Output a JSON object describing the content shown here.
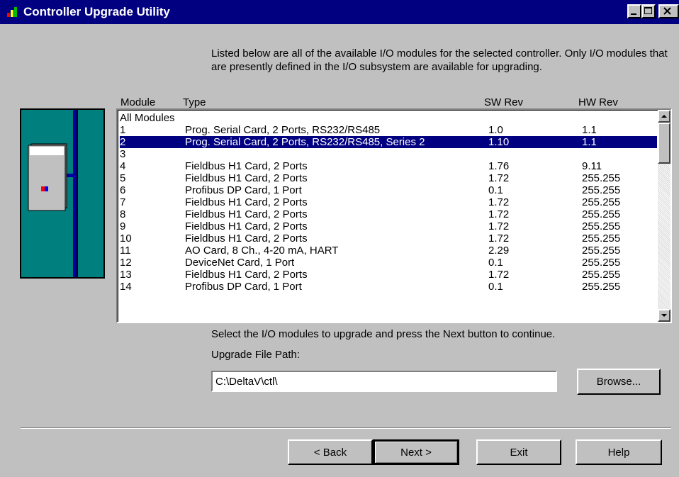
{
  "window": {
    "title": "Controller Upgrade Utility"
  },
  "intro_text": "Listed below are all of the available I/O modules for the selected controller. Only I/O modules that are presently defined in the I/O subsystem are available for upgrading.",
  "list": {
    "columns": [
      "Module",
      "Type",
      "SW Rev",
      "HW Rev"
    ],
    "rows": [
      {
        "module": "All Modules",
        "type": "",
        "sw": "",
        "hw": ""
      },
      {
        "module": "1",
        "type": "Prog. Serial Card, 2 Ports, RS232/RS485",
        "sw": "1.0",
        "hw": "1.1"
      },
      {
        "module": "2",
        "type": "Prog. Serial Card, 2 Ports, RS232/RS485, Series 2",
        "sw": "1.10",
        "hw": "1.1"
      },
      {
        "module": "3",
        "type": "",
        "sw": "",
        "hw": ""
      },
      {
        "module": "4",
        "type": "Fieldbus H1 Card, 2 Ports",
        "sw": "1.76",
        "hw": "9.11"
      },
      {
        "module": "5",
        "type": "Fieldbus H1 Card, 2 Ports",
        "sw": "1.72",
        "hw": "255.255"
      },
      {
        "module": "6",
        "type": "Profibus DP Card, 1 Port",
        "sw": "0.1",
        "hw": "255.255"
      },
      {
        "module": "7",
        "type": "Fieldbus H1 Card, 2 Ports",
        "sw": "1.72",
        "hw": "255.255"
      },
      {
        "module": "8",
        "type": "Fieldbus H1 Card, 2 Ports",
        "sw": "1.72",
        "hw": "255.255"
      },
      {
        "module": "9",
        "type": "Fieldbus H1 Card, 2 Ports",
        "sw": "1.72",
        "hw": "255.255"
      },
      {
        "module": "10",
        "type": "Fieldbus H1 Card, 2 Ports",
        "sw": "1.72",
        "hw": "255.255"
      },
      {
        "module": "11",
        "type": "AO Card, 8 Ch., 4-20 mA, HART",
        "sw": "2.29",
        "hw": "255.255"
      },
      {
        "module": "12",
        "type": "DeviceNet Card, 1 Port",
        "sw": "0.1",
        "hw": "255.255"
      },
      {
        "module": "13",
        "type": "Fieldbus H1 Card, 2 Ports",
        "sw": "1.72",
        "hw": "255.255"
      },
      {
        "module": "14",
        "type": "Profibus DP Card, 1 Port",
        "sw": "0.1",
        "hw": "255.255"
      }
    ],
    "selected_index": 2
  },
  "instruction_text": "Select the I/O modules to upgrade and press the Next button to continue.",
  "upgrade_path": {
    "label": "Upgrade File Path:",
    "value": "C:\\DeltaV\\ctl\\"
  },
  "buttons": {
    "browse": "Browse...",
    "back": "< Back",
    "next": "Next >",
    "exit": "Exit",
    "help": "Help"
  },
  "colors": {
    "titlebar": "#000080",
    "face": "#c0c0c0",
    "illustration": "#007f7f",
    "selection": "#000080"
  }
}
